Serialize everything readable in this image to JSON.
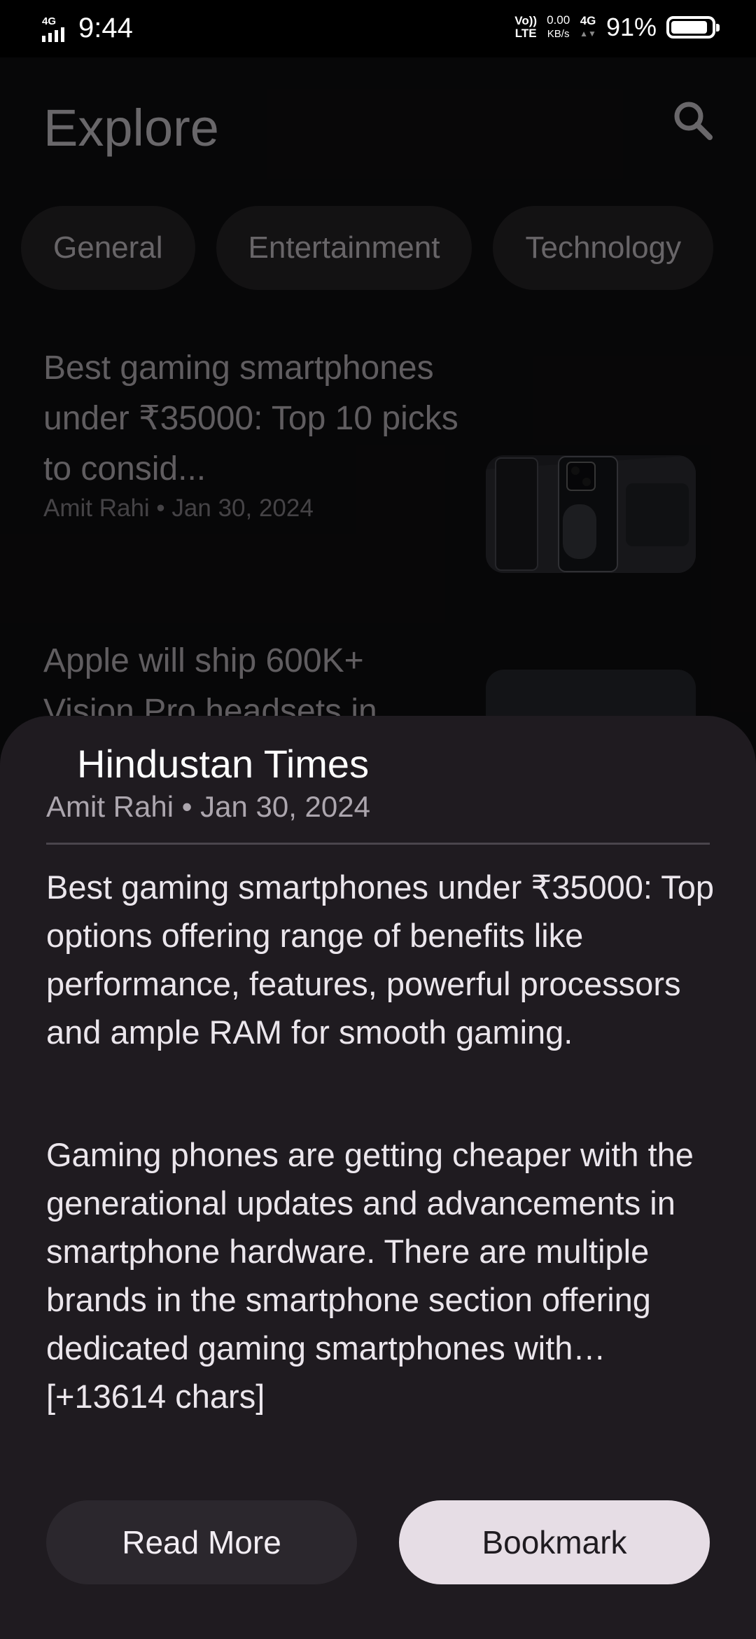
{
  "status_bar": {
    "network_tag": "4G",
    "time": "9:44",
    "volte_top": "Vo))",
    "volte_bottom": "LTE",
    "speed_value": "0.00",
    "speed_unit": "KB/s",
    "network_type": "4G",
    "battery_percent": "91%"
  },
  "header": {
    "title": "Explore",
    "search_icon": "search-icon"
  },
  "categories": [
    "General",
    "Entertainment",
    "Technology"
  ],
  "articles": [
    {
      "headline": "Best gaming smartphones under ₹35000: Top 10 picks to consid...",
      "meta": "Amit Rahi • Jan 30, 2024"
    },
    {
      "headline": "Apple will ship 600K+ Vision Pro headsets in",
      "meta": ""
    }
  ],
  "sheet": {
    "source": "Hindustan Times",
    "meta": "Amit Rahi • Jan 30, 2024",
    "summary": "Best gaming smartphones under ₹35000: Top options offering range of benefits like performance, features, powerful processors and ample RAM for smooth gaming.",
    "body": "Gaming phones are getting cheaper with the generational updates and advancements in smartphone hardware. There are multiple brands in the smartphone section offering dedicated gaming smartphones with… [+13614 chars]",
    "read_more_label": "Read More",
    "bookmark_label": "Bookmark"
  },
  "colors": {
    "background": "#111012",
    "sheet": "#1f1b20",
    "bookmark_button": "#e6dde5",
    "read_more_button": "#2b272d"
  }
}
